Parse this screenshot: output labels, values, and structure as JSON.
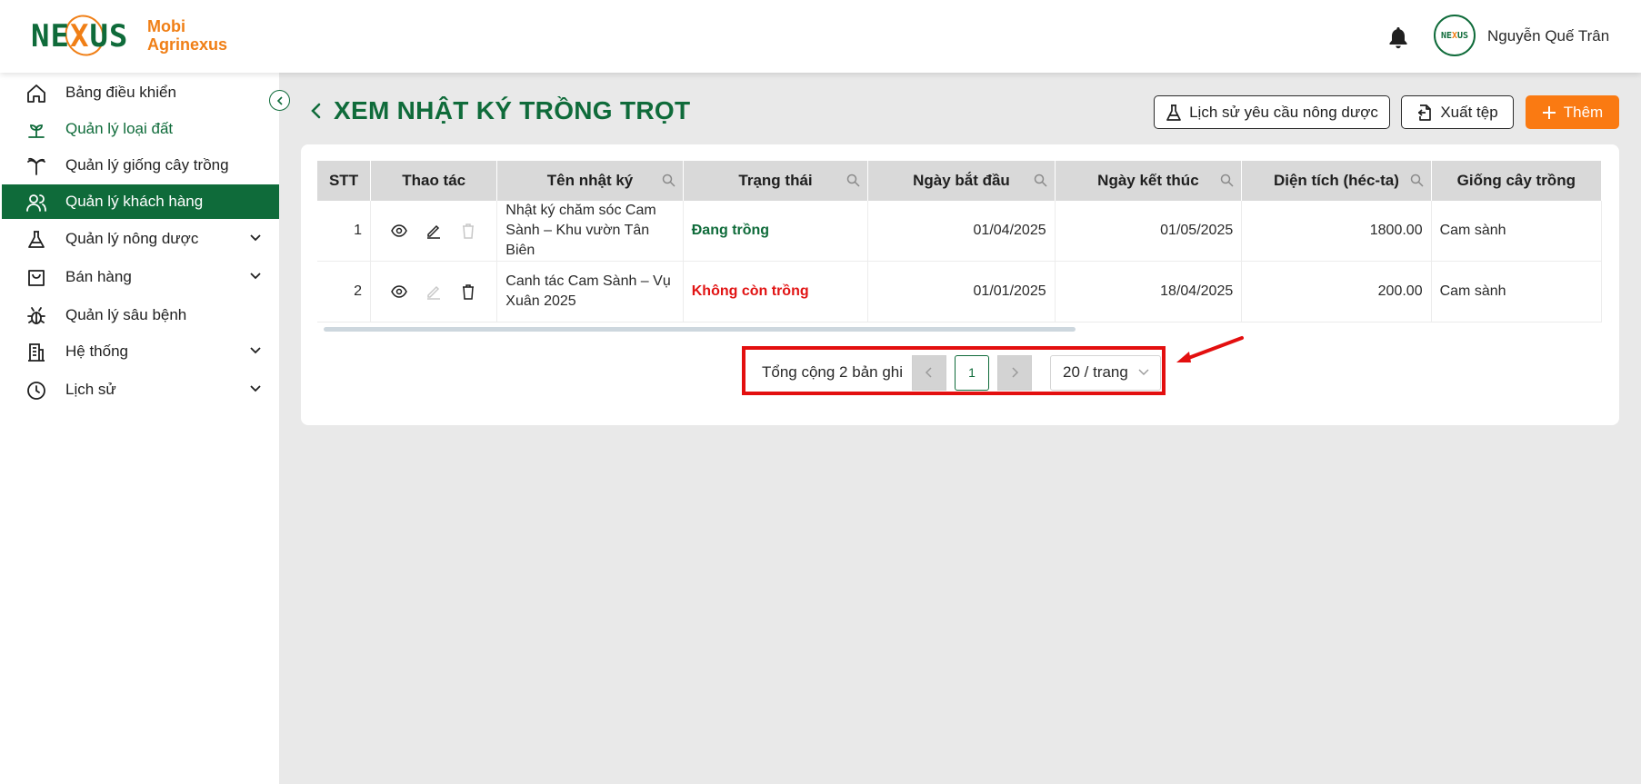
{
  "app": {
    "logo_word_left": "NE",
    "logo_word_x": "X",
    "logo_word_right": "US",
    "logo_text_line1": "Mobi",
    "logo_text_line2": "Agrinexus",
    "brand_color": "#0f6b3a",
    "accent_color": "#fa7a12"
  },
  "header": {
    "user_name": "Nguyễn Quế Trân",
    "notification_icon": "bell-icon"
  },
  "sidebar": {
    "items": [
      {
        "label": "Bảng điều khiển",
        "icon": "home-icon"
      },
      {
        "label": "Quản lý loại đất",
        "icon": "sprout-icon"
      },
      {
        "label": "Quản lý giống cây trồng",
        "icon": "palm-tree-icon"
      },
      {
        "label": "Quản lý khách hàng",
        "icon": "users-icon"
      },
      {
        "label": "Quản lý nông dược",
        "icon": "flask-icon"
      },
      {
        "label": "Bán hàng",
        "icon": "shopping-bag-icon"
      },
      {
        "label": "Quản lý sâu bệnh",
        "icon": "bug-icon"
      },
      {
        "label": "Hệ thống",
        "icon": "building-icon"
      },
      {
        "label": "Lịch sử",
        "icon": "clock-icon"
      }
    ]
  },
  "page": {
    "title": "XEM NHẬT KÝ TRỒNG TRỌT",
    "btn_history": "Lịch sử yêu cầu nông dược",
    "btn_export": "Xuất tệp",
    "btn_add": "Thêm"
  },
  "table": {
    "columns": [
      "STT",
      "Thao tác",
      "Tên nhật ký",
      "Trạng thái",
      "Ngày bắt đầu",
      "Ngày kết thúc",
      "Diện tích (héc-ta)",
      "Giống cây trồng"
    ],
    "rows": [
      {
        "stt": "1",
        "name": "Nhật ký chăm sóc Cam Sành – Khu vườn Tân Biên",
        "status": "Đang trồng",
        "start": "01/04/2025",
        "end": "01/05/2025",
        "area": "1800.00",
        "variety": "Cam sành"
      },
      {
        "stt": "2",
        "name": "Canh tác Cam Sành – Vụ Xuân 2025",
        "status": "Không còn trồng",
        "start": "01/01/2025",
        "end": "18/04/2025",
        "area": "200.00",
        "variety": "Cam sành"
      }
    ]
  },
  "pagination": {
    "total_text": "Tổng cộng 2 bản ghi",
    "current_page": "1",
    "page_size": "20 / trang"
  }
}
